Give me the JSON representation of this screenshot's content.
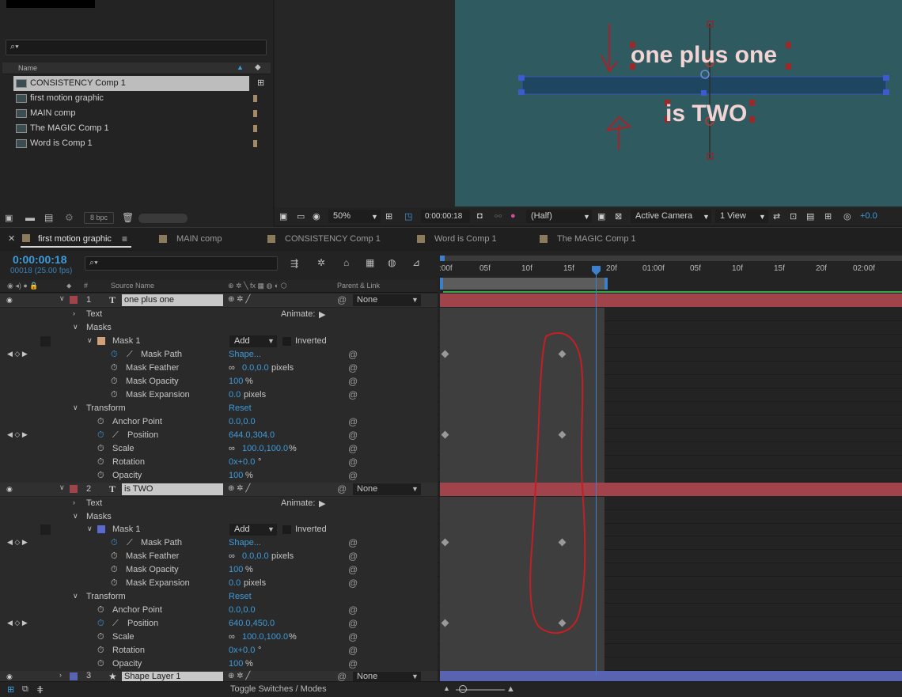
{
  "project": {
    "search_placeholder": "",
    "column_name": "Name",
    "items": [
      {
        "label": "CONSISTENCY Comp 1",
        "selected": true
      },
      {
        "label": "first motion graphic",
        "selected": false
      },
      {
        "label": "MAIN comp",
        "selected": false
      },
      {
        "label": "The MAGIC  Comp 1",
        "selected": false
      },
      {
        "label": "Word is Comp 1",
        "selected": false
      }
    ],
    "bpc": "8 bpc"
  },
  "viewer": {
    "text_top": "one plus one",
    "text_bottom": "is TWO",
    "zoom": "50%",
    "timecode": "0:00:00:18",
    "resolution": "(Half)",
    "camera": "Active Camera",
    "view": "1 View",
    "exposure": "+0.0"
  },
  "tabs": [
    {
      "label": "first motion graphic",
      "active": true,
      "menu": "≡"
    },
    {
      "label": "MAIN comp",
      "active": false
    },
    {
      "label": "CONSISTENCY Comp 1",
      "active": false
    },
    {
      "label": "Word is Comp 1",
      "active": false
    },
    {
      "label": "The MAGIC  Comp 1",
      "active": false
    }
  ],
  "timeline": {
    "timecode": "0:00:00:18",
    "fps": "00018 (25.00 fps)",
    "col_source": "Source Name",
    "col_parent": "Parent & Link",
    "ruler": [
      ":00f",
      "05f",
      "10f",
      "15f",
      "20f",
      "01:00f",
      "05f",
      "10f",
      "15f",
      "20f",
      "02:00f"
    ],
    "layer1": {
      "num": "1",
      "name": "one plus one",
      "parent": "None",
      "text": "Text",
      "animate": "Animate:",
      "masks": "Masks",
      "mask1": "Mask 1",
      "mode": "Add",
      "inverted": "Inverted",
      "mask_path": "Mask Path",
      "mask_path_val": "Shape...",
      "mask_feather": "Mask Feather",
      "mask_feather_val": "0.0,0.0",
      "pixels": "pixels",
      "mask_opacity": "Mask Opacity",
      "mask_opacity_val": "100",
      "pct": "%",
      "mask_expansion": "Mask Expansion",
      "mask_expansion_val": "0.0",
      "transform": "Transform",
      "reset": "Reset",
      "anchor": "Anchor Point",
      "anchor_val": "0.0,0.0",
      "position": "Position",
      "position_val": "644.0,304.0",
      "scale": "Scale",
      "scale_val": "100.0,100.0",
      "rotation": "Rotation",
      "rotation_val": "0x+0.0",
      "rotation_unit": "°",
      "opacity": "Opacity",
      "opacity_val": "100"
    },
    "layer2": {
      "num": "2",
      "name": "is TWO",
      "parent": "None",
      "text": "Text",
      "animate": "Animate:",
      "masks": "Masks",
      "mask1": "Mask 1",
      "mode": "Add",
      "inverted": "Inverted",
      "mask_path": "Mask Path",
      "mask_path_val": "Shape...",
      "mask_feather": "Mask Feather",
      "mask_feather_val": "0.0,0.0",
      "pixels": "pixels",
      "mask_opacity": "Mask Opacity",
      "mask_opacity_val": "100",
      "pct": "%",
      "mask_expansion": "Mask Expansion",
      "mask_expansion_val": "0.0",
      "transform": "Transform",
      "reset": "Reset",
      "anchor": "Anchor Point",
      "anchor_val": "0.0,0.0",
      "position": "Position",
      "position_val": "640.0,450.0",
      "scale": "Scale",
      "scale_val": "100.0,100.0",
      "rotation": "Rotation",
      "rotation_val": "0x+0.0",
      "rotation_unit": "°",
      "opacity": "Opacity",
      "opacity_val": "100"
    },
    "layer3": {
      "num": "3",
      "name": "Shape Layer 1",
      "parent": "None"
    },
    "footer_toggle": "Toggle Switches / Modes"
  },
  "colors": {
    "accent": "#3d9bdc",
    "layer_red": "#a1434a",
    "layer_blue": "#5863b1",
    "comp_bg": "#2f5a60"
  }
}
